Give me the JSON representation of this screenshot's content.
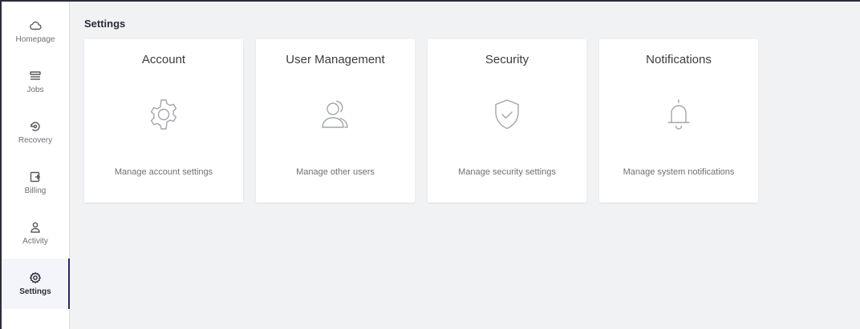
{
  "sidebar": {
    "items": [
      {
        "label": "Homepage",
        "icon": "cloud-icon",
        "active": false
      },
      {
        "label": "Jobs",
        "icon": "stack-icon",
        "active": false
      },
      {
        "label": "Recovery",
        "icon": "recovery-icon",
        "active": false
      },
      {
        "label": "Billing",
        "icon": "billing-icon",
        "active": false
      },
      {
        "label": "Activity",
        "icon": "person-icon",
        "active": false
      },
      {
        "label": "Settings",
        "icon": "gear-icon",
        "active": true
      }
    ]
  },
  "main": {
    "title": "Settings",
    "cards": [
      {
        "title": "Account",
        "icon": "gear-icon",
        "description": "Manage account settings"
      },
      {
        "title": "User Management",
        "icon": "users-icon",
        "description": "Manage other users"
      },
      {
        "title": "Security",
        "icon": "shield-check-icon",
        "description": "Manage security settings"
      },
      {
        "title": "Notifications",
        "icon": "bell-icon",
        "description": "Manage system notifications"
      }
    ]
  },
  "colors": {
    "accent": "#2a2a5c",
    "background": "#f1f2f3",
    "card": "#ffffff",
    "icon_gray": "#a2a5aa"
  }
}
